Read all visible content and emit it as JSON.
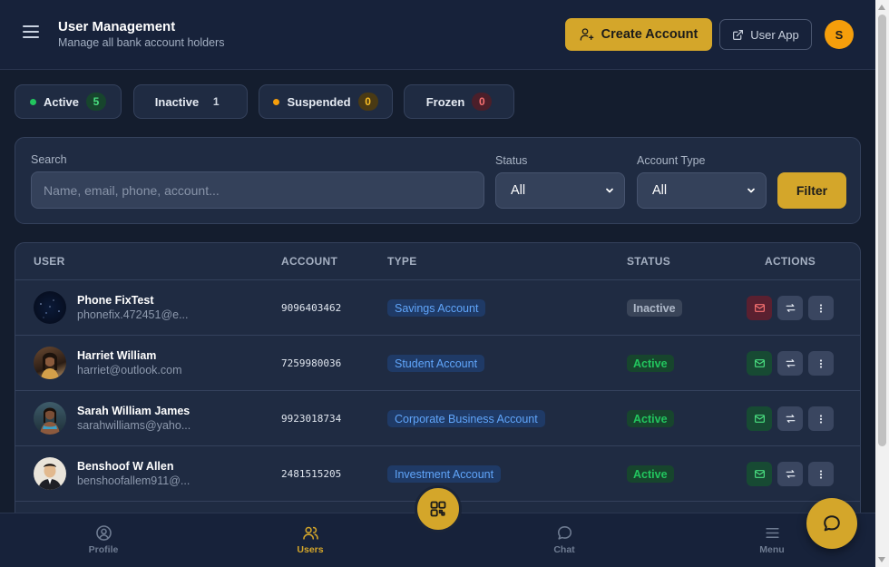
{
  "header": {
    "title": "User Management",
    "subtitle": "Manage all bank account holders",
    "create_label": "Create Account",
    "user_app_label": "User App",
    "avatar_initial": "S"
  },
  "status_chips": [
    {
      "label": "Active",
      "count": "5",
      "color": "#22c55e"
    },
    {
      "label": "Inactive",
      "count": "1"
    },
    {
      "label": "Suspended",
      "count": "0",
      "color": "#f59e0b"
    },
    {
      "label": "Frozen",
      "count": "0"
    }
  ],
  "filters": {
    "search_label": "Search",
    "search_placeholder": "Name, email, phone, account...",
    "status_label": "Status",
    "status_value": "All",
    "type_label": "Account Type",
    "type_value": "All",
    "filter_button": "Filter"
  },
  "table": {
    "columns": [
      "USER",
      "ACCOUNT",
      "TYPE",
      "STATUS",
      "ACTIONS"
    ],
    "rows": [
      {
        "name": "Phone FixTest",
        "email": "phonefix.472451@e...",
        "account": "9096403462",
        "type": "Savings Account",
        "status": "Inactive"
      },
      {
        "name": "Harriet William",
        "email": "harriet@outlook.com",
        "account": "7259980036",
        "type": "Student Account",
        "status": "Active"
      },
      {
        "name": "Sarah William James",
        "email": "sarahwilliams@yaho...",
        "account": "9923018734",
        "type": "Corporate Business Account",
        "status": "Active"
      },
      {
        "name": "Benshoof W Allen",
        "email": "benshoofallem911@...",
        "account": "2481515205",
        "type": "Investment Account",
        "status": "Active"
      }
    ]
  },
  "bottom_nav": {
    "profile": "Profile",
    "users": "Users",
    "chat": "Chat",
    "menu": "Menu"
  },
  "colors": {
    "accent": "#d4a62a",
    "active_green": "#22c55e",
    "badge_blue": "#60a5fa"
  },
  "icons": {
    "menu": "hamburger-icon",
    "create": "user-plus-icon",
    "external": "external-link-icon",
    "mail": "mail-icon",
    "transfer": "arrows-exchange-icon",
    "more": "more-vertical-icon",
    "chevron": "chevron-down-icon",
    "profile": "user-circle-icon",
    "users": "users-icon",
    "grid": "grid-icon",
    "chat": "chat-bubble-icon",
    "nav_menu": "menu-lines-icon"
  }
}
